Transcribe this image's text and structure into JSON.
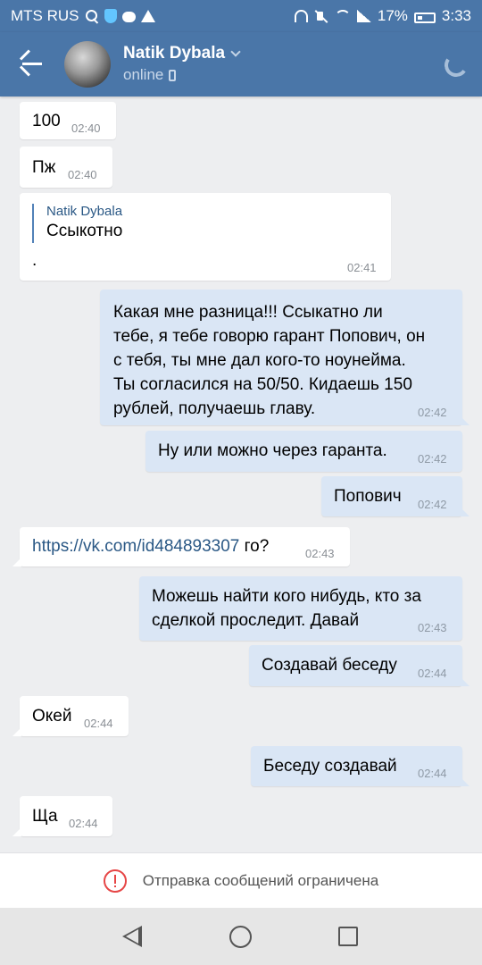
{
  "status_bar": {
    "carrier": "MTS RUS",
    "battery": "17%",
    "time": "3:33",
    "icons": [
      "search-icon",
      "shield-icon",
      "chat-icon",
      "warning-icon",
      "headset-icon",
      "mute-icon",
      "wifi-icon",
      "signal-icon",
      "battery-icon"
    ]
  },
  "header": {
    "name": "Natik Dybala",
    "status": "online",
    "accent": "#4a76a8"
  },
  "messages": [
    {
      "dir": "in",
      "text": "100",
      "time": "02:40"
    },
    {
      "dir": "in",
      "text": "Пж",
      "time": "02:40"
    },
    {
      "dir": "in",
      "forward_from": "Natik Dybala",
      "forward_text": "Ссыкотно",
      "text": ".",
      "time": "02:41"
    },
    {
      "dir": "out",
      "lines": [
        "Какая мне разница!!! Ссыкатно ли",
        "тебе, я тебе говорю гарант Попович, он",
        "с тебя, ты мне дал кого-то ноунейма.",
        "Ты согласился на 50/50. Кидаешь 150",
        "рублей, получаешь главу."
      ],
      "time": "02:42"
    },
    {
      "dir": "out",
      "text": "Ну или можно через гаранта.",
      "time": "02:42"
    },
    {
      "dir": "out",
      "text": "Попович",
      "time": "02:42"
    },
    {
      "dir": "in",
      "link": "https://vk.com/id484893307",
      "text": " го?",
      "time": "02:43"
    },
    {
      "dir": "out",
      "lines": [
        "Можешь найти кого нибудь, кто за",
        "сделкой проследит. Давай"
      ],
      "time": "02:43"
    },
    {
      "dir": "out",
      "text": "Создавай беседу",
      "time": "02:44"
    },
    {
      "dir": "in",
      "text": "Окей",
      "time": "02:44"
    },
    {
      "dir": "out",
      "text": "Беседу создавай",
      "time": "02:44"
    },
    {
      "dir": "in",
      "text": "Ща",
      "time": "02:44"
    }
  ],
  "restriction": {
    "text": "Отправка сообщений ограничена",
    "color": "#e64646"
  },
  "nav": {
    "icons": [
      "nav-back-icon",
      "nav-home-icon",
      "nav-recent-icon"
    ]
  }
}
